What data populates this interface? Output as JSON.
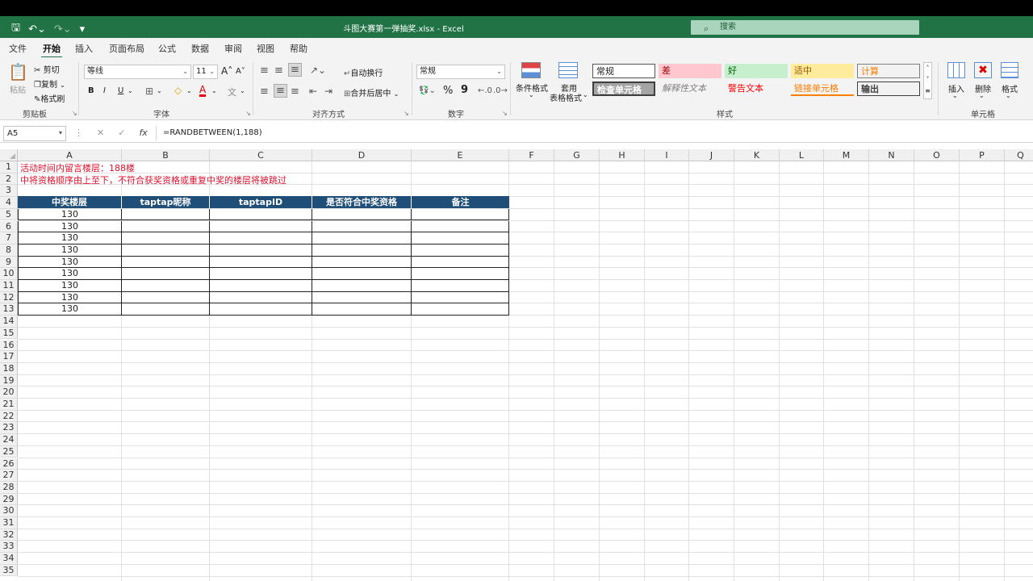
{
  "window": {
    "title": "斗图大赛第一弹抽奖.xlsx  -  Excel",
    "search_placeholder": "搜索"
  },
  "tabs": [
    "文件",
    "开始",
    "插入",
    "页面布局",
    "公式",
    "数据",
    "审阅",
    "视图",
    "帮助"
  ],
  "active_tab": "开始",
  "ribbon": {
    "clipboard": {
      "paste": "粘贴",
      "cut": "剪切",
      "copy": "复制",
      "format_painter": "格式刷",
      "label": "剪贴板"
    },
    "font": {
      "name": "等线",
      "size": "11",
      "bold": "B",
      "italic": "I",
      "underline": "U",
      "label": "字体"
    },
    "alignment": {
      "wrap": "自动换行",
      "merge": "合并后居中",
      "label": "对齐方式"
    },
    "number": {
      "format": "常规",
      "percent": "%",
      "comma": "9",
      "label": "数字"
    },
    "styles": {
      "conditional": "条件格式",
      "table_format_1": "套用",
      "table_format_2": "表格格式",
      "cells": [
        "常规",
        "差",
        "好",
        "适中",
        "计算",
        "检查单元格",
        "解释性文本",
        "警告文本",
        "链接单元格",
        "输出"
      ],
      "label": "样式"
    },
    "cells": {
      "insert": "插入",
      "delete": "删除",
      "format": "格式",
      "label": "单元格"
    }
  },
  "formula_bar": {
    "name_box": "A5",
    "formula": "=RANDBETWEEN(1,188)",
    "fx": "fx"
  },
  "sheet": {
    "columns": [
      "A",
      "B",
      "C",
      "D",
      "E",
      "F",
      "G",
      "H",
      "I",
      "J",
      "K",
      "L",
      "M",
      "N",
      "O",
      "P",
      "Q"
    ],
    "rows": [
      "1",
      "2",
      "3",
      "4",
      "5",
      "6",
      "7",
      "8",
      "9",
      "10",
      "11",
      "12",
      "13",
      "14",
      "15",
      "16",
      "17",
      "18",
      "19",
      "20",
      "21",
      "22",
      "23",
      "24",
      "25",
      "26",
      "27",
      "28",
      "29",
      "30",
      "31",
      "32",
      "33",
      "34",
      "35"
    ],
    "note_line1": "活动时间内留言楼层：188楼",
    "note_line2": "中将资格顺序由上至下，不符合获奖资格或重复中奖的楼层将被跳过",
    "table_headers": [
      "中奖楼层",
      "taptap昵称",
      "taptapID",
      "是否符合中奖资格",
      "备注"
    ],
    "floor_values": [
      "130",
      "130",
      "130",
      "130",
      "130",
      "130",
      "130",
      "130",
      "130"
    ]
  }
}
